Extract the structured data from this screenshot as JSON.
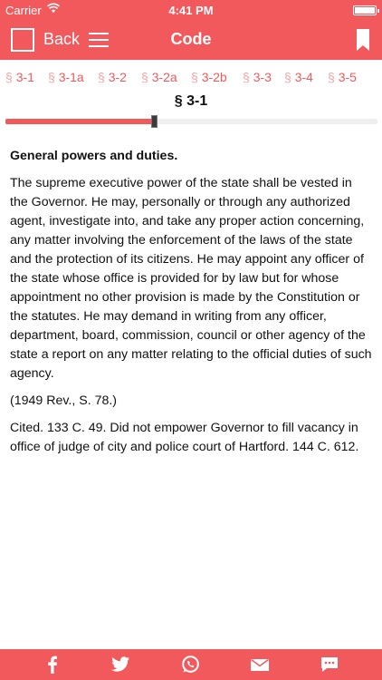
{
  "status": {
    "carrier": "Carrier",
    "time": "4:41 PM",
    "battery_level": 1.0
  },
  "nav": {
    "back_label": "Back",
    "title": "Code"
  },
  "tabs": [
    {
      "sym": "§",
      "label": "3-1"
    },
    {
      "sym": "§",
      "label": "3-1a"
    },
    {
      "sym": "§",
      "label": "3-2"
    },
    {
      "sym": "§",
      "label": "3-2a"
    },
    {
      "sym": "§",
      "label": "3-2b"
    },
    {
      "sym": "§",
      "label": "3-3"
    },
    {
      "sym": "§",
      "label": "3-4"
    },
    {
      "sym": "§",
      "label": "3-5"
    }
  ],
  "section": {
    "title": "§ 3-1"
  },
  "progress": {
    "value": 0.4
  },
  "content": {
    "heading": "General powers and duties.",
    "body": "The supreme executive power of the state shall be vested in the Governor. He may, personally or through any authorized agent, investigate into, and take any proper action concerning, any matter involving the enforcement of the laws of the state and the protection of its citizens. He may appoint any officer of the state whose office is provided for by law but for whose appointment no other provision is made by the Constitution or the statutes. He may demand in writing from any officer, department, board, commission, council or other agency of the state a report on any matter relating to the official duties of such agency.",
    "history": "(1949 Rev., S. 78.)",
    "annotation": "Cited. 133 C. 49. Did not empower Governor to fill vacancy in office of judge of city and police court of Hartford. 144 C. 612."
  },
  "share": [
    "facebook-icon",
    "twitter-icon",
    "whatsapp-icon",
    "mail-icon",
    "message-icon"
  ],
  "colors": {
    "accent": "#f2595c",
    "tab_symbol": "#f4a4a6"
  }
}
